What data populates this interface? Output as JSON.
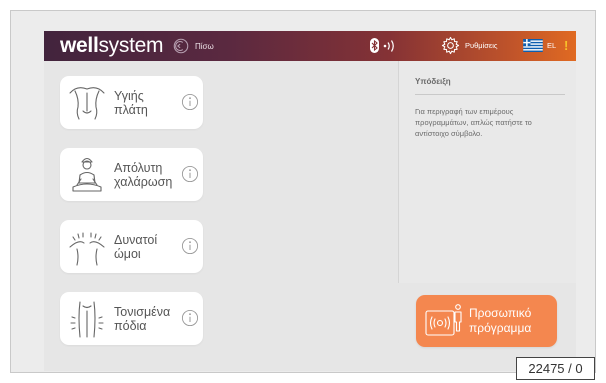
{
  "header": {
    "logo_bold": "well",
    "logo_light": "system",
    "back_label": "Πίσω",
    "settings_label": "Ρυθμίσεις",
    "language": "EL",
    "warning": "!"
  },
  "programs": [
    {
      "label": "Υγιής\nπλάτη",
      "icon": "healthy-back-icon"
    },
    {
      "label": "Απόλυτη\nχαλάρωση",
      "icon": "relaxation-icon"
    },
    {
      "label": "Δυνατοί\nώμοι",
      "icon": "shoulders-icon"
    },
    {
      "label": "Τονισμένα\nπόδια",
      "icon": "legs-icon"
    }
  ],
  "hint": {
    "title": "Υπόδειξη",
    "text": "Για περιγραφή των επιμέρους προγραμμάτων, απλώς πατήστε το αντίστοιχο σύμβολο."
  },
  "personal_program": {
    "label": "Προσωπικό\nπρόγραμμα"
  },
  "figure_number": "22475 / 0",
  "colors": {
    "header_start": "#42243d",
    "header_end": "#e06a22",
    "accent": "#f4874f",
    "warning": "#f7c12a"
  }
}
